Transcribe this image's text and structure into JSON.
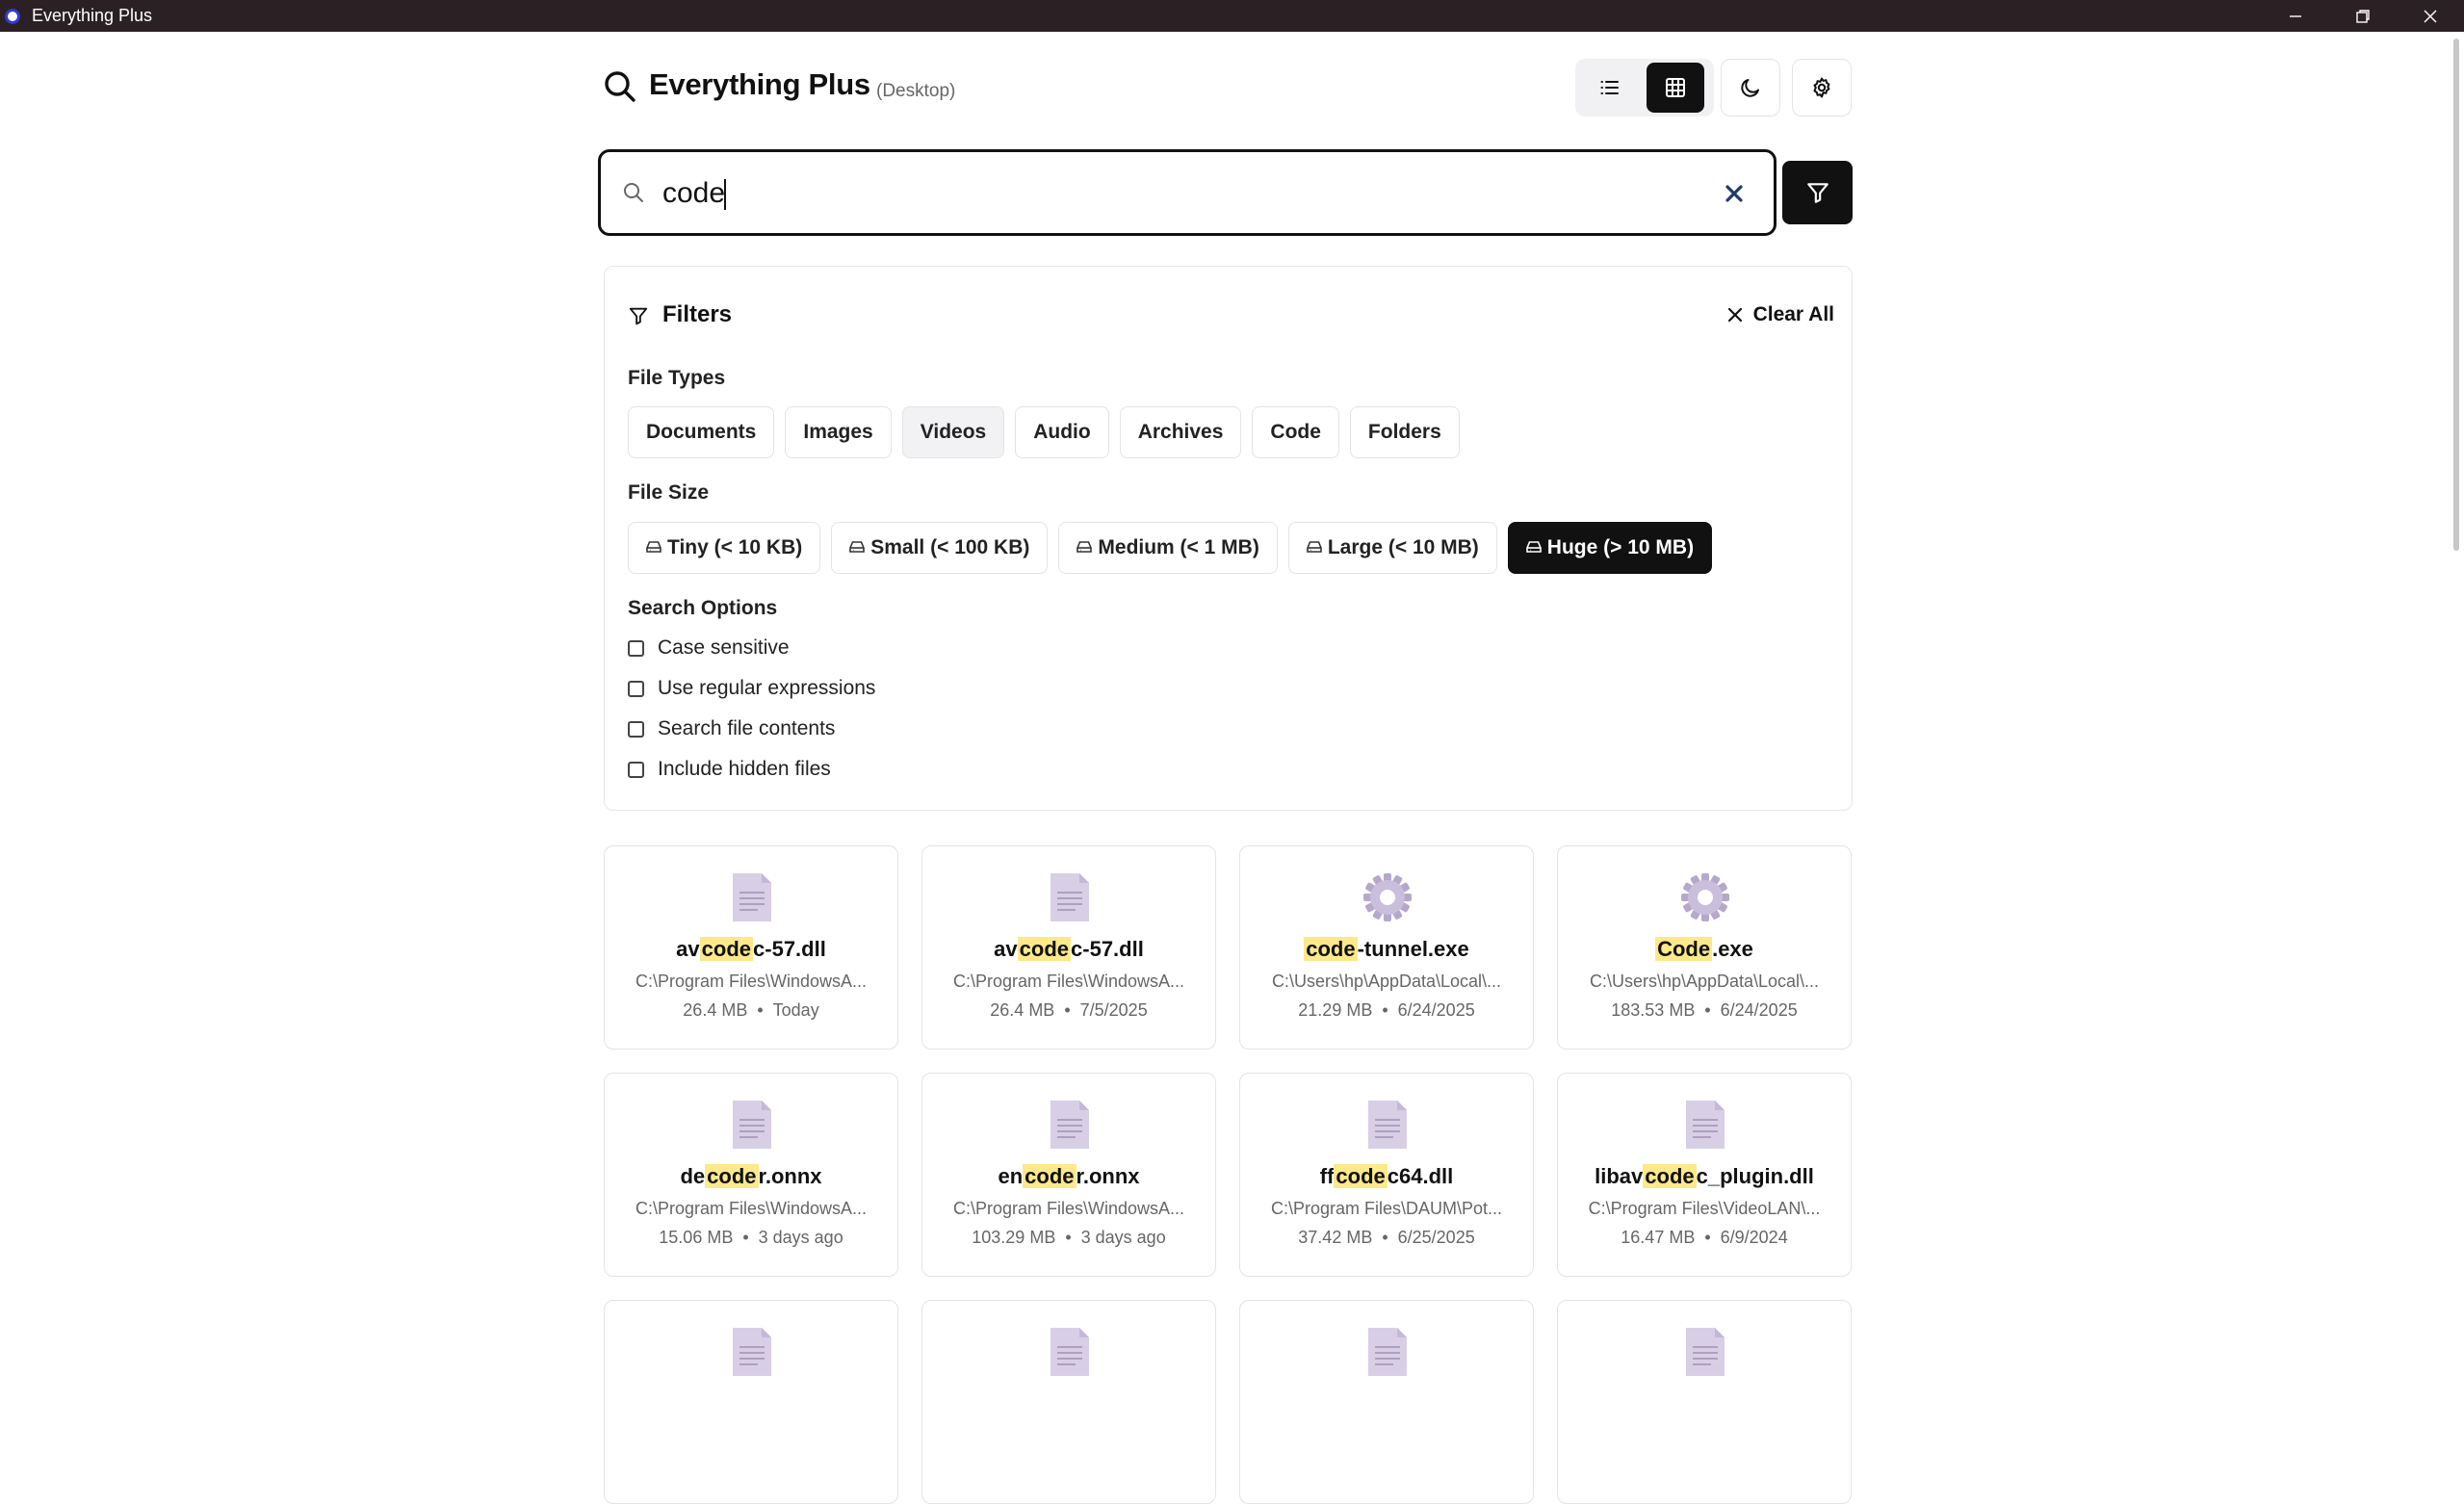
{
  "window": {
    "title": "Everything Plus"
  },
  "header": {
    "title": "Everything Plus",
    "subtitle": "(Desktop)",
    "view_mode": "grid"
  },
  "search": {
    "query": "code"
  },
  "filters": {
    "title": "Filters",
    "clear_all": "Clear All",
    "file_types_label": "File Types",
    "file_types": [
      {
        "label": "Documents",
        "state": "default"
      },
      {
        "label": "Images",
        "state": "default"
      },
      {
        "label": "Videos",
        "state": "hover"
      },
      {
        "label": "Audio",
        "state": "default"
      },
      {
        "label": "Archives",
        "state": "default"
      },
      {
        "label": "Code",
        "state": "default"
      },
      {
        "label": "Folders",
        "state": "default"
      }
    ],
    "file_size_label": "File Size",
    "file_sizes": [
      {
        "label": "Tiny (< 10 KB)",
        "state": "default"
      },
      {
        "label": "Small (< 100 KB)",
        "state": "default"
      },
      {
        "label": "Medium (< 1 MB)",
        "state": "default"
      },
      {
        "label": "Large (< 10 MB)",
        "state": "default"
      },
      {
        "label": "Huge (> 10 MB)",
        "state": "active"
      }
    ],
    "search_options_label": "Search Options",
    "options": [
      {
        "label": "Case sensitive",
        "checked": false
      },
      {
        "label": "Use regular expressions",
        "checked": false
      },
      {
        "label": "Search file contents",
        "checked": false
      },
      {
        "label": "Include hidden files",
        "checked": false
      }
    ]
  },
  "results": [
    {
      "pre": "av",
      "match": "code",
      "post": "c-57.dll",
      "path": "C:\\Program Files\\WindowsA...",
      "size": "26.4 MB",
      "date": "Today",
      "icon": "document-icon"
    },
    {
      "pre": "av",
      "match": "code",
      "post": "c-57.dll",
      "path": "C:\\Program Files\\WindowsA...",
      "size": "26.4 MB",
      "date": "7/5/2025",
      "icon": "document-icon"
    },
    {
      "pre": "",
      "match": "code",
      "post": "-tunnel.exe",
      "path": "C:\\Users\\hp\\AppData\\Local\\...",
      "size": "21.29 MB",
      "date": "6/24/2025",
      "icon": "gear-icon"
    },
    {
      "pre": "",
      "match": "Code",
      "post": ".exe",
      "path": "C:\\Users\\hp\\AppData\\Local\\...",
      "size": "183.53 MB",
      "date": "6/24/2025",
      "icon": "gear-icon"
    },
    {
      "pre": "de",
      "match": "code",
      "post": "r.onnx",
      "path": "C:\\Program Files\\WindowsA...",
      "size": "15.06 MB",
      "date": "3 days ago",
      "icon": "document-icon"
    },
    {
      "pre": "en",
      "match": "code",
      "post": "r.onnx",
      "path": "C:\\Program Files\\WindowsA...",
      "size": "103.29 MB",
      "date": "3 days ago",
      "icon": "document-icon"
    },
    {
      "pre": "ff",
      "match": "code",
      "post": "c64.dll",
      "path": "C:\\Program Files\\DAUM\\Pot...",
      "size": "37.42 MB",
      "date": "6/25/2025",
      "icon": "document-icon"
    },
    {
      "pre": "libav",
      "match": "code",
      "post": "c_plugin.dll",
      "path": "C:\\Program Files\\VideoLAN\\...",
      "size": "16.47 MB",
      "date": "6/9/2024",
      "icon": "document-icon"
    },
    {
      "pre": "",
      "match": "",
      "post": "",
      "path": "",
      "size": "",
      "date": "",
      "icon": "document-icon"
    },
    {
      "pre": "",
      "match": "",
      "post": "",
      "path": "",
      "size": "",
      "date": "",
      "icon": "document-icon"
    },
    {
      "pre": "",
      "match": "",
      "post": "",
      "path": "",
      "size": "",
      "date": "",
      "icon": "document-icon"
    },
    {
      "pre": "",
      "match": "",
      "post": "",
      "path": "",
      "size": "",
      "date": "",
      "icon": "document-icon"
    }
  ],
  "meta_separator": "•",
  "colors": {
    "accent": "#111111",
    "highlight": "#fde98a",
    "file_icon": "#d8cfe6",
    "clear_x": "#1f3a6b"
  }
}
